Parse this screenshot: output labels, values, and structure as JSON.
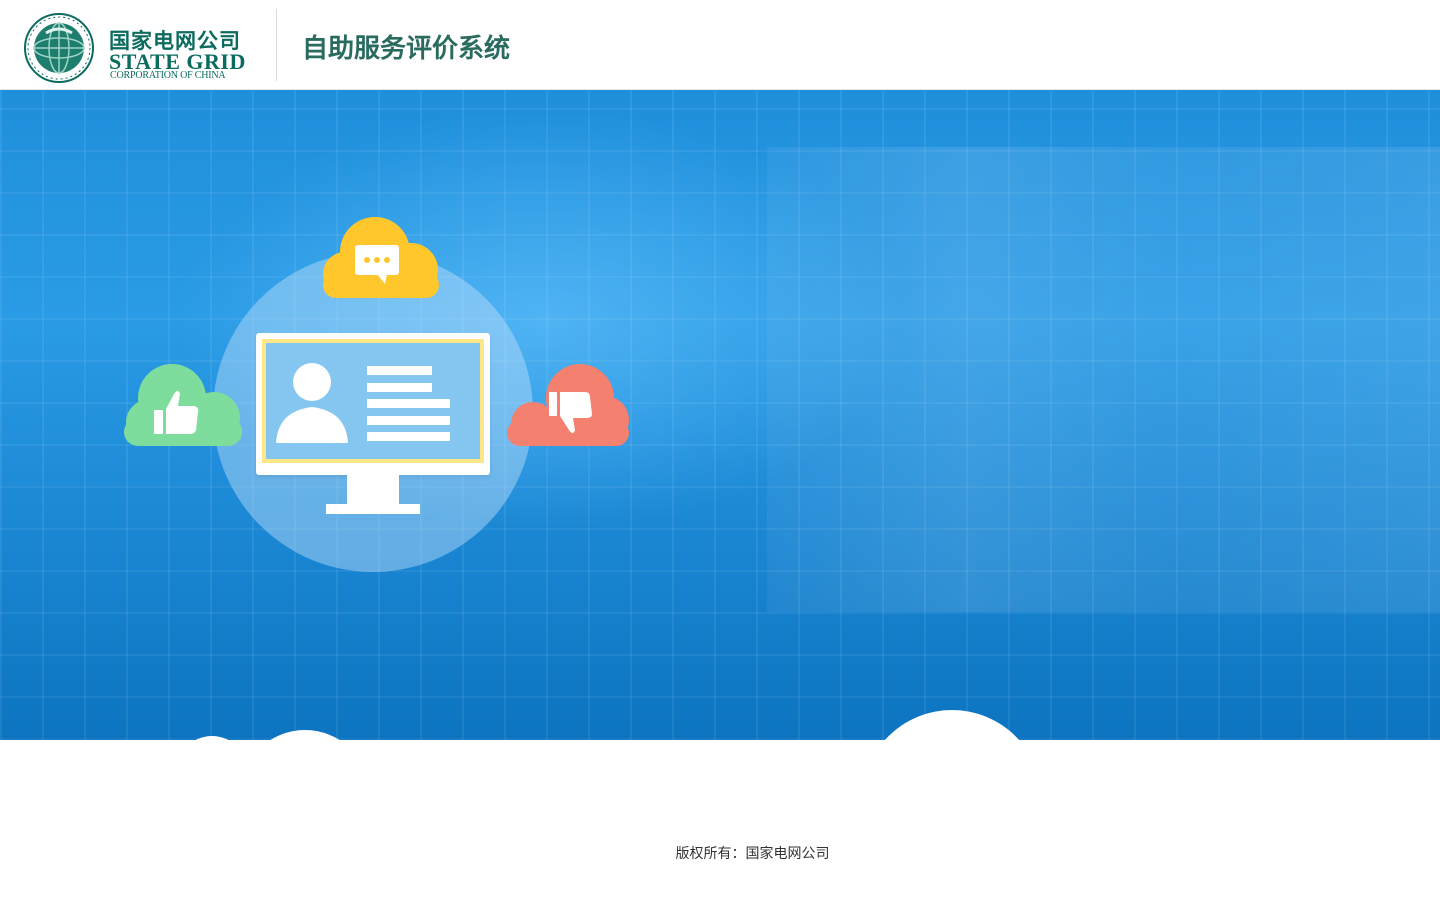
{
  "header": {
    "logo_cn": "国家电网公司",
    "logo_en_line1": "STATE GRID",
    "logo_en_line2": "CORPORATION OF CHINA",
    "app_title": "自助服务评价系统"
  },
  "hero": {
    "illustration_icons": [
      "chat-bubble-icon",
      "thumbs-up-icon",
      "thumbs-down-icon",
      "user-profile-icon"
    ]
  },
  "footer": {
    "copyright": "版权所有：国家电网公司"
  },
  "colors": {
    "brand_green": "#0b6b5e",
    "hero_blue": "#1f8fdc",
    "cloud_yellow": "#ffc72c",
    "cloud_green": "#7edc9d",
    "cloud_red": "#f4806f"
  }
}
